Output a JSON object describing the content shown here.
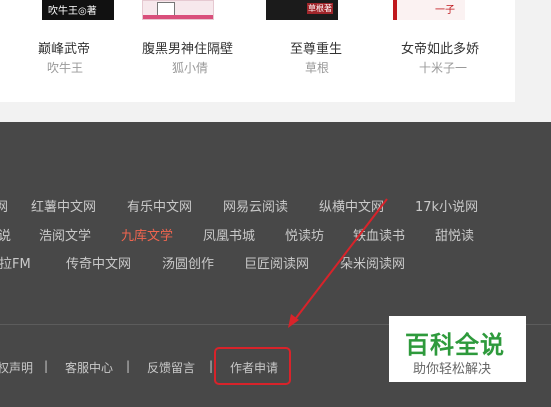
{
  "books": [
    {
      "title": "巅峰武帝",
      "author": "吹牛王",
      "cover_text": "吹牛王◎著"
    },
    {
      "title": "腹黑男神住隔壁",
      "author": "狐小倩",
      "cover_text": ""
    },
    {
      "title": "至尊重生",
      "author": "草根",
      "cover_text": "草根著"
    },
    {
      "title": "女帝如此多娇",
      "author": "十米子一",
      "cover_text": "一子"
    }
  ],
  "friend_links": {
    "row1": [
      "网",
      "红薯中文网",
      "有乐中文网",
      "网易云阅读",
      "纵横中文网",
      "17k小说网"
    ],
    "row2": [
      "说",
      "浩阅文学",
      "九库文学",
      "凤凰书城",
      "悦读坊",
      "铁血读书",
      "甜悦读"
    ],
    "row3": [
      "考拉FM",
      "传奇中文网",
      "汤圆创作",
      "巨匠阅读网",
      "朵米阅读网"
    ]
  },
  "bottom_links": [
    "权声明",
    "|",
    "客服中心",
    "|",
    "反馈留言",
    "|",
    "作者申请"
  ],
  "highlight_color": "#f0654f",
  "annotation_color": "#d8232a",
  "watermark": {
    "title": "百科全说",
    "subtitle": "助你轻松解决"
  }
}
